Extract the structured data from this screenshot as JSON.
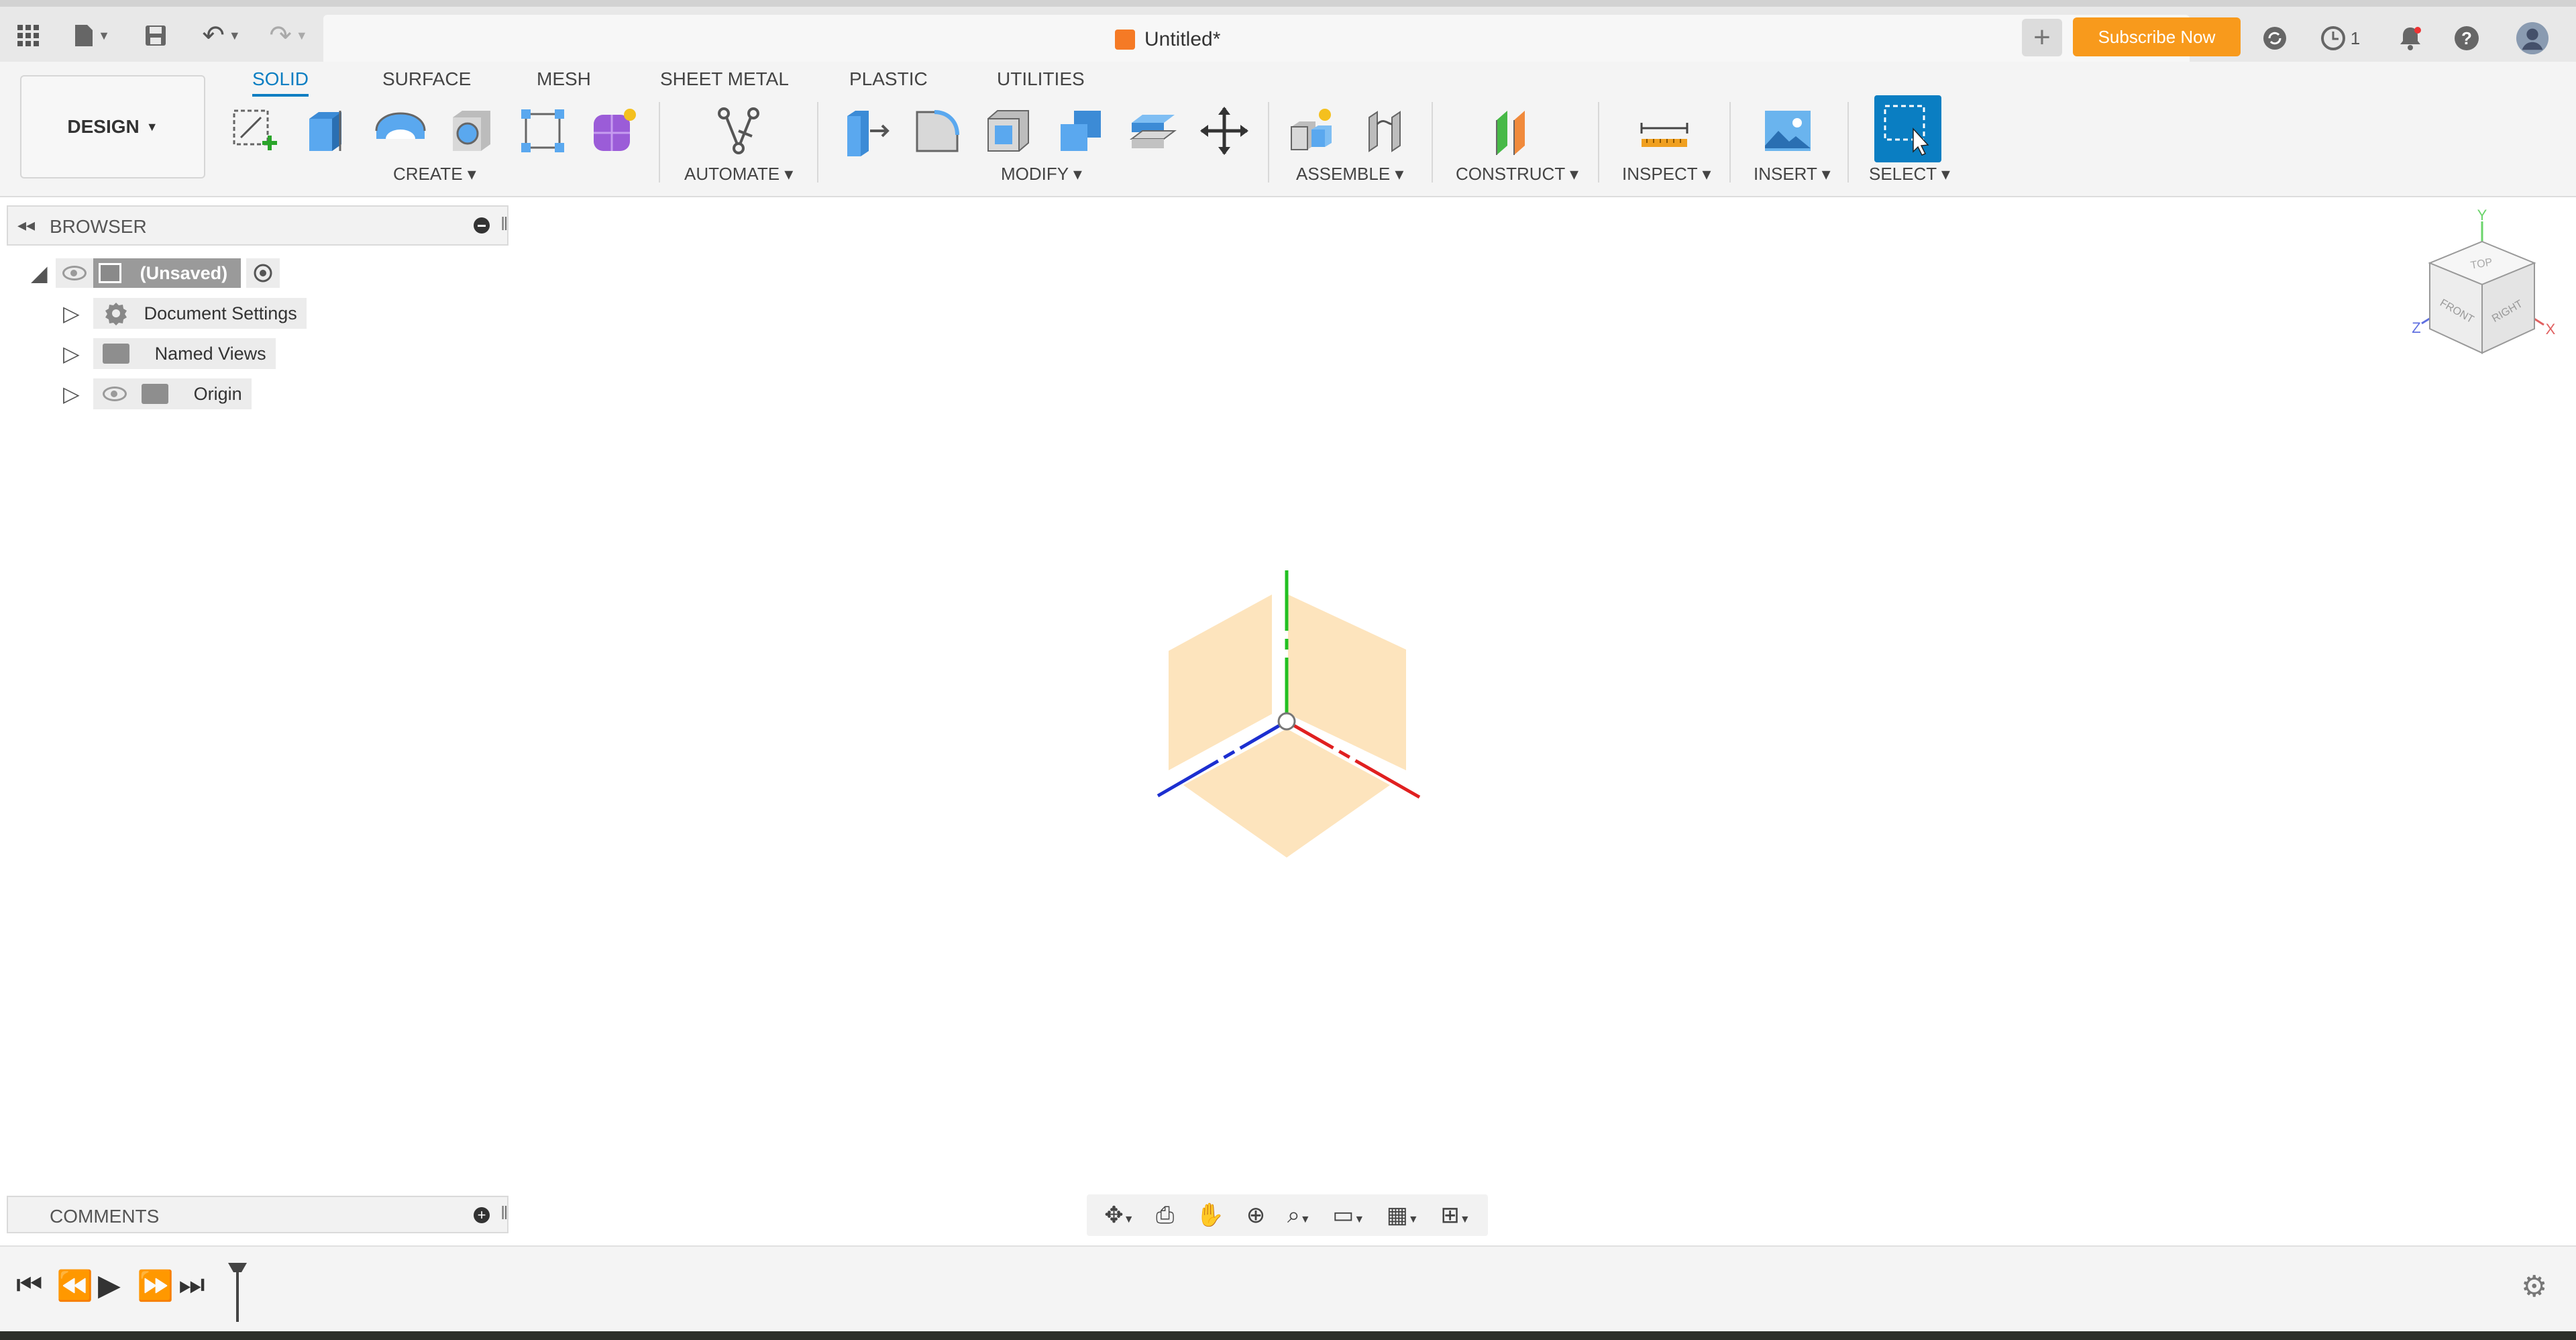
{
  "titlebar": {
    "doc_title": "Untitled*",
    "subscribe_label": "Subscribe Now",
    "jobs_count": "1"
  },
  "workspace": {
    "label": "DESIGN"
  },
  "ribbon_tabs": [
    "SOLID",
    "SURFACE",
    "MESH",
    "SHEET METAL",
    "PLASTIC",
    "UTILITIES"
  ],
  "groups": {
    "create": "CREATE",
    "automate": "AUTOMATE",
    "modify": "MODIFY",
    "assemble": "ASSEMBLE",
    "construct": "CONSTRUCT",
    "inspect": "INSPECT",
    "insert": "INSERT",
    "select": "SELECT"
  },
  "browser": {
    "title": "BROWSER",
    "root": "(Unsaved)",
    "items": [
      "Document Settings",
      "Named Views",
      "Origin"
    ]
  },
  "viewcube": {
    "top": "TOP",
    "front": "FRONT",
    "right": "RIGHT",
    "x": "X",
    "y": "Y",
    "z": "Z"
  },
  "comments": {
    "title": "COMMENTS"
  },
  "colors": {
    "accent": "#0a7ec2",
    "subscribe": "#f89a1c",
    "plane": "#fde4bd",
    "axis_x": "#e02020",
    "axis_y": "#22c022",
    "axis_z": "#1c2fd0"
  }
}
